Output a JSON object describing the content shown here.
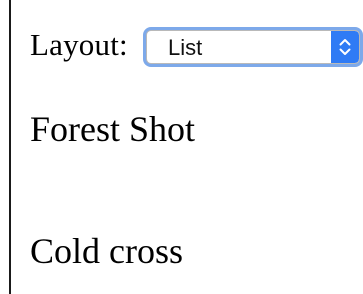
{
  "layout_control": {
    "label": "Layout:",
    "selected": "List"
  },
  "items": [
    {
      "label": "Forest Shot"
    },
    {
      "label": "Cold cross"
    }
  ],
  "colors": {
    "focus_ring": "#7da9ea",
    "select_arrow_bg": "#2f7bf5"
  },
  "icons": {
    "select_arrow": "chevron-updown-icon"
  }
}
